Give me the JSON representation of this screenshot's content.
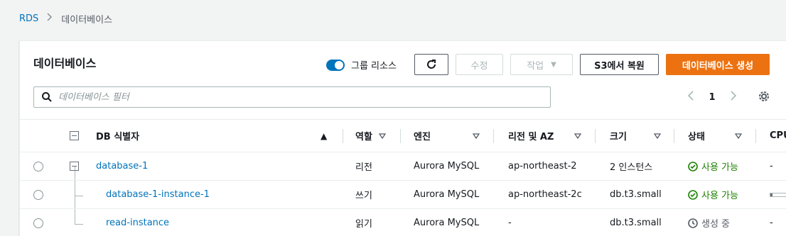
{
  "breadcrumb": {
    "root": "RDS",
    "current": "데이터베이스"
  },
  "panel": {
    "title": "데이터베이스",
    "group_toggle_label": "그룹 리소스",
    "buttons": {
      "edit": "수정",
      "actions": "작업",
      "restore": "S3에서 복원",
      "create": "데이터베이스 생성"
    },
    "search_placeholder": "데이터베이스 필터",
    "page_number": "1"
  },
  "columns": {
    "db_id": "DB 식별자",
    "role": "역할",
    "engine": "엔진",
    "region": "리전 및 AZ",
    "size": "크기",
    "status": "상태",
    "cpu": "CPU"
  },
  "rows": [
    {
      "id": "database-1",
      "role": "리전",
      "engine": "Aurora MySQL",
      "region": "ap-northeast-2",
      "size": "2 인스턴스",
      "status": "사용 가능",
      "status_kind": "available",
      "cpu": "-"
    },
    {
      "id": "database-1-instance-1",
      "role": "쓰기",
      "engine": "Aurora MySQL",
      "region": "ap-northeast-2c",
      "size": "db.t3.small",
      "status": "사용 가능",
      "status_kind": "available",
      "cpu_bar_fraction": 0.12
    },
    {
      "id": "read-instance",
      "role": "읽기",
      "engine": "Aurora MySQL",
      "region": "-",
      "size": "db.t3.small",
      "status": "생성 중",
      "status_kind": "creating",
      "cpu": "-"
    }
  ],
  "colors": {
    "link": "#0073bb",
    "primary": "#ec7211",
    "success": "#1d8102"
  }
}
